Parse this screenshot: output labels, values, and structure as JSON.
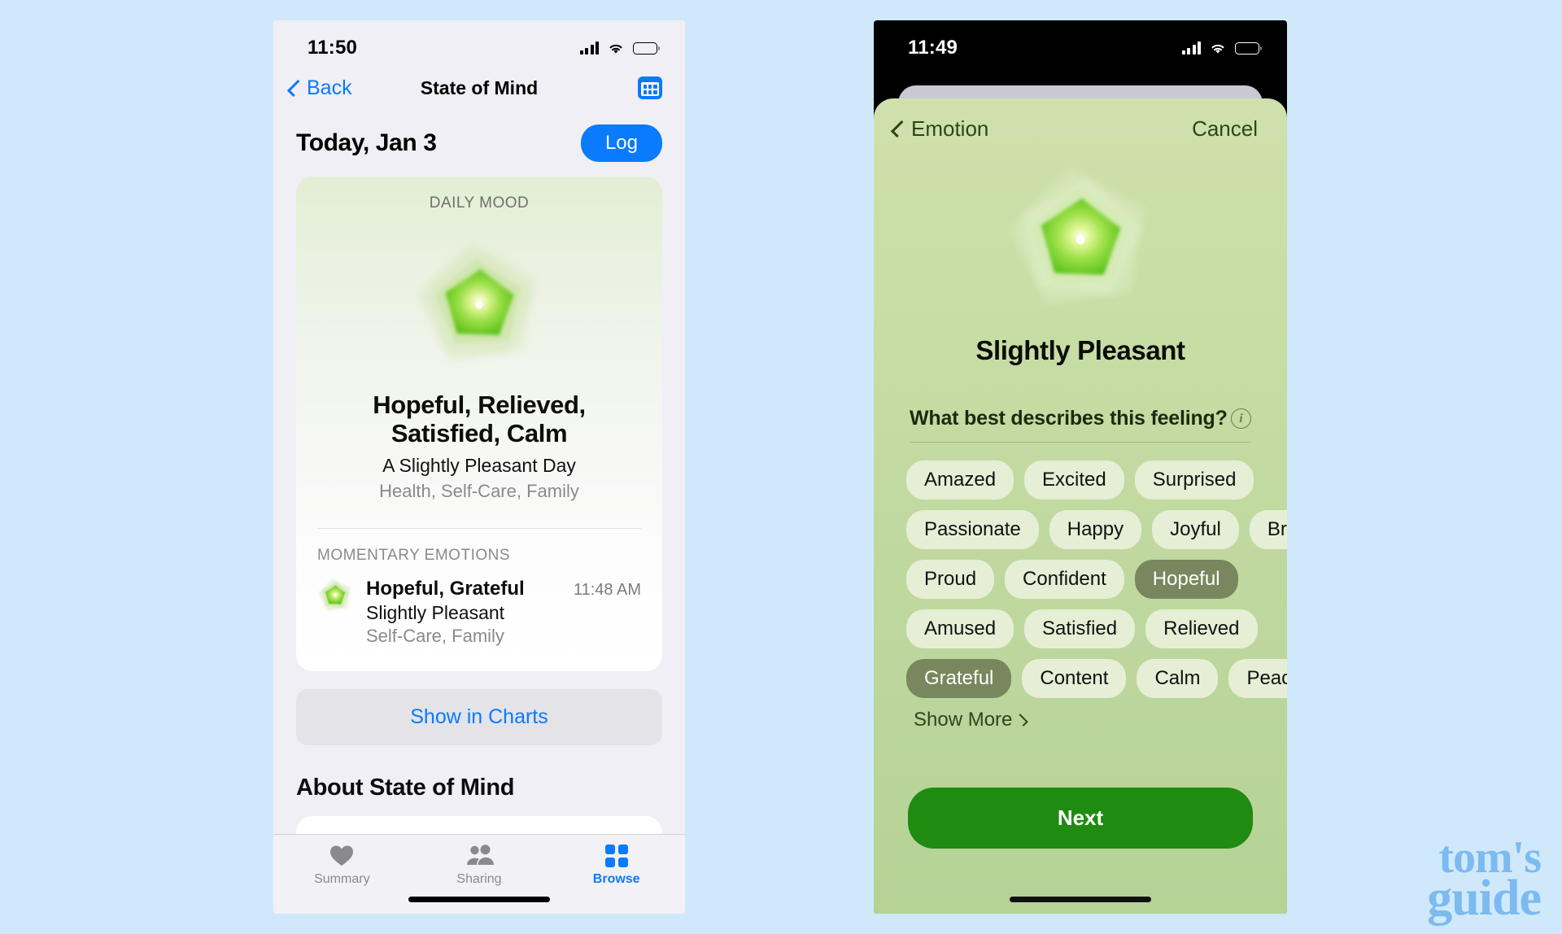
{
  "page": {
    "background_color": "#cfe9fb",
    "watermark": {
      "line1": "tom's",
      "line2": "guide",
      "color": "#7cbaf0"
    }
  },
  "left_phone": {
    "status_bar": {
      "time": "11:50",
      "signal": "signal-bars-icon",
      "wifi": "wifi-icon",
      "battery": "battery-icon"
    },
    "nav_bar": {
      "back_label": "Back",
      "title": "State of Mind",
      "calendar_icon": "calendar-icon",
      "accent_color": "#0a7aff"
    },
    "day_header": {
      "title": "Today, Jan 3",
      "log_label": "Log"
    },
    "mood_card": {
      "label": "DAILY MOOD",
      "visual": "mood-pentagon-graphic",
      "title": "Hopeful, Relieved, Satisfied, Calm",
      "subtitle": "A Slightly Pleasant Day",
      "tags": "Health, Self-Care, Family",
      "section_label": "MOMENTARY EMOTIONS",
      "entry": {
        "icon": "mood-pentagon-small-icon",
        "name": "Hopeful, Grateful",
        "valence": "Slightly Pleasant",
        "tags": "Self-Care, Family",
        "time": "11:48 AM"
      }
    },
    "show_in_charts_label": "Show in Charts",
    "about_title": "About State of Mind",
    "tab_bar": [
      {
        "label": "Summary",
        "icon": "heart-icon",
        "active": false
      },
      {
        "label": "Sharing",
        "icon": "people-icon",
        "active": false
      },
      {
        "label": "Browse",
        "icon": "grid-icon",
        "active": true
      }
    ]
  },
  "right_phone": {
    "status_bar": {
      "time": "11:49",
      "signal": "signal-bars-icon",
      "wifi": "wifi-icon",
      "battery": "battery-icon"
    },
    "nav_bar": {
      "back_label": "Emotion",
      "cancel_label": "Cancel"
    },
    "visual": "mood-pentagon-graphic",
    "title": "Slightly Pleasant",
    "question": "What best describes this feeling?",
    "info_icon": "info-circle-icon",
    "chip_rows": [
      [
        {
          "label": "Amazed",
          "selected": false
        },
        {
          "label": "Excited",
          "selected": false
        },
        {
          "label": "Surprised",
          "selected": false
        }
      ],
      [
        {
          "label": "Passionate",
          "selected": false
        },
        {
          "label": "Happy",
          "selected": false
        },
        {
          "label": "Joyful",
          "selected": false
        },
        {
          "label": "Brave",
          "selected": false
        }
      ],
      [
        {
          "label": "Proud",
          "selected": false
        },
        {
          "label": "Confident",
          "selected": false
        },
        {
          "label": "Hopeful",
          "selected": true
        }
      ],
      [
        {
          "label": "Amused",
          "selected": false
        },
        {
          "label": "Satisfied",
          "selected": false
        },
        {
          "label": "Relieved",
          "selected": false
        }
      ],
      [
        {
          "label": "Grateful",
          "selected": true
        },
        {
          "label": "Content",
          "selected": false
        },
        {
          "label": "Calm",
          "selected": false
        },
        {
          "label": "Peaceful",
          "selected": false
        }
      ]
    ],
    "show_more_label": "Show More",
    "next_label": "Next",
    "colors": {
      "sheet": "#c6dda4",
      "chip": "#e6efd6",
      "chip_selected": "#78875e",
      "next_button": "#1f8b10"
    }
  }
}
